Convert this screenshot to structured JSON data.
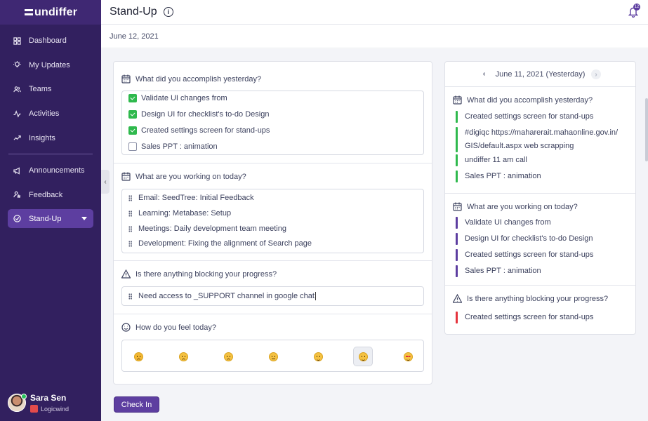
{
  "app": {
    "logo": "undiffer"
  },
  "sidebar": {
    "items": [
      {
        "label": "Dashboard",
        "icon": "dashboard-icon"
      },
      {
        "label": "My Updates",
        "icon": "bulb-icon"
      },
      {
        "label": "Teams",
        "icon": "users-icon"
      },
      {
        "label": "Activities",
        "icon": "activity-icon"
      },
      {
        "label": "Insights",
        "icon": "insights-icon"
      },
      {
        "label": "Announcements",
        "icon": "megaphone-icon"
      },
      {
        "label": "Feedback",
        "icon": "feedback-icon"
      },
      {
        "label": "Stand-Up",
        "icon": "check-circle-icon"
      }
    ],
    "user": {
      "name": "Sara Sen",
      "company": "Logicwind"
    }
  },
  "header": {
    "title": "Stand-Up",
    "notification_count": "12"
  },
  "date": "June 12, 2021",
  "form": {
    "yesterday": {
      "question": "What did you accomplish yesterday?",
      "items": [
        {
          "text": "Validate UI changes from",
          "checked": true
        },
        {
          "text": "Design UI for checklist's to-do Design",
          "checked": true
        },
        {
          "text": "Created settings screen for stand-ups",
          "checked": true
        },
        {
          "text": "Sales PPT : animation",
          "checked": false
        }
      ]
    },
    "today": {
      "question": "What are you working on today?",
      "items": [
        "Email: SeedTree: Initial Feedback",
        "Learning: Metabase: Setup",
        "Meetings: Daily development team meeting",
        "Development: Fixing the alignment of Search page"
      ]
    },
    "blocking": {
      "question": "Is there anything blocking your progress?",
      "value": "Need access to _SUPPORT channel in google chat"
    },
    "feeling": {
      "question": "How do you feel today?",
      "selected_index": 5
    },
    "submit_label": "Check In"
  },
  "previous": {
    "date_label": "June 11, 2021 (Yesterday)",
    "yesterday": {
      "question": "What did you accomplish yesterday?",
      "items": [
        "Created settings screen for stand-ups",
        "#digiqc https://maharerait.mahaonline.gov.in/ GIS/default.aspx web scrapping",
        "undiffer 11 am call",
        "Sales PPT : animation"
      ]
    },
    "today": {
      "question": "What are you working on today?",
      "items": [
        "Validate UI changes from",
        "Design UI for checklist's to-do Design",
        "Created settings screen for stand-ups",
        "Sales PPT : animation"
      ]
    },
    "blocking": {
      "question": "Is there anything blocking your progress?",
      "items": [
        "Created settings screen for stand-ups"
      ]
    }
  },
  "colors": {
    "sidebar": "#32205f",
    "accent": "#5d3ea0",
    "done": "#2fb94d",
    "today": "#5d3ea0",
    "blocker": "#e5343d"
  }
}
